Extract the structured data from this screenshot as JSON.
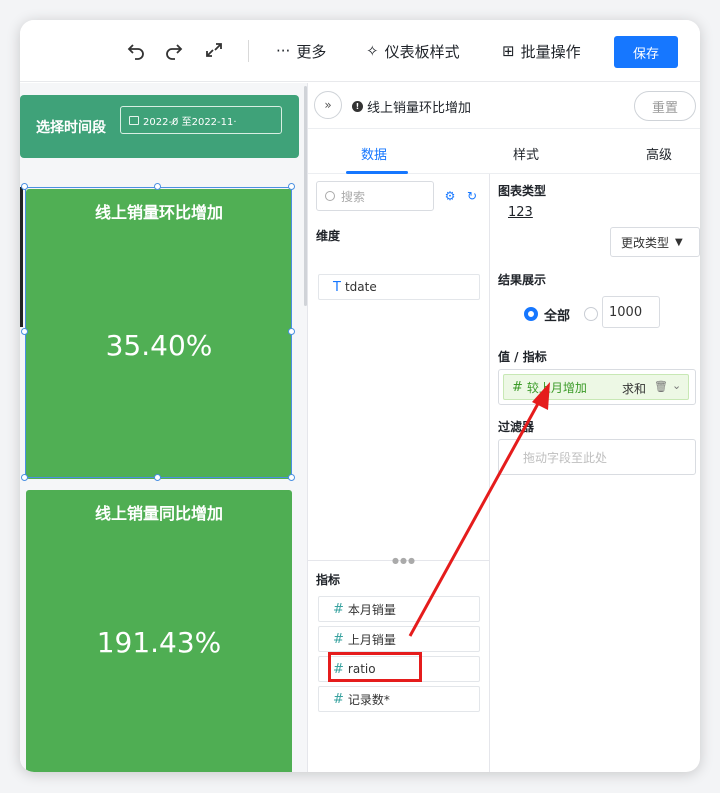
{
  "toolbar": {
    "more_label": "更多",
    "dashboard_style_label": "仪表板样式",
    "batch_ops_label": "批量操作",
    "save_label": "保存"
  },
  "canvas": {
    "filter_label": "选择时间段",
    "date_range": "2022-0̸ 至2022-11·",
    "cards": [
      {
        "title": "线上销量环比增加",
        "value": "35.40%"
      },
      {
        "title": "线上销量同比增加",
        "value": "191.43%"
      }
    ]
  },
  "editor": {
    "title": "线上销量环比增加",
    "reset_label": "重置",
    "tabs": [
      {
        "label": "数据"
      },
      {
        "label": "样式"
      },
      {
        "label": "高级"
      }
    ],
    "search_placeholder": "搜索",
    "dimension_label": "维度",
    "dimensions": [
      {
        "label": "tdate",
        "type": "T"
      }
    ],
    "measure_label": "指标",
    "measures": [
      {
        "label": "本月销量",
        "type": "#"
      },
      {
        "label": "上月销量",
        "type": "#"
      },
      {
        "label": "ratio",
        "type": "#"
      },
      {
        "label": "记录数*",
        "type": "#"
      }
    ],
    "chart_type_label": "图表类型",
    "chart_type_value": "123",
    "change_type_label": "更改类型",
    "result_label": "结果展示",
    "result_all_label": "全部",
    "result_limit": "1000",
    "value_metric_label": "值 / 指标",
    "metric_field": "较上月增加",
    "metric_agg": "求和",
    "filter_label": "过滤器",
    "filter_placeholder": "拖动字段至此处"
  },
  "colors": {
    "accent": "#1677ff",
    "card_green": "#50af54",
    "filter_bar": "#3fa279",
    "annotation_red": "#e51c1c"
  }
}
